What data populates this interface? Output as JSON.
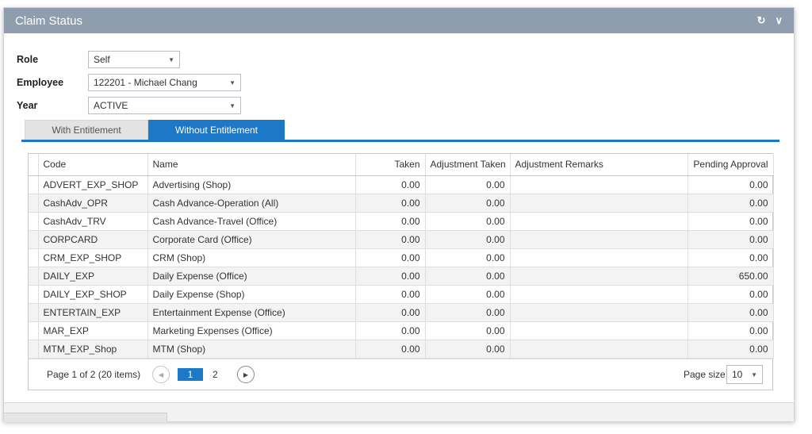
{
  "panel": {
    "title": "Claim Status",
    "refresh_icon": "refresh-icon",
    "collapse_icon": "chevron-down-icon"
  },
  "filters": {
    "role": {
      "label": "Role",
      "value": "Self"
    },
    "employee": {
      "label": "Employee",
      "value": "122201 - Michael Chang"
    },
    "year": {
      "label": "Year",
      "value": "ACTIVE"
    }
  },
  "tabs": [
    {
      "label": "With Entitlement",
      "active": false
    },
    {
      "label": "Without Entitlement",
      "active": true
    }
  ],
  "grid": {
    "headers": [
      "Code",
      "Name",
      "Taken",
      "Adjustment Taken",
      "Adjustment Remarks",
      "Pending Approval"
    ],
    "rows": [
      [
        "ADVERT_EXP_SHOP",
        "Advertising (Shop)",
        "0.00",
        "0.00",
        "",
        "0.00"
      ],
      [
        "CashAdv_OPR",
        "Cash Advance-Operation (All)",
        "0.00",
        "0.00",
        "",
        "0.00"
      ],
      [
        "CashAdv_TRV",
        "Cash Advance-Travel (Office)",
        "0.00",
        "0.00",
        "",
        "0.00"
      ],
      [
        "CORPCARD",
        "Corporate Card (Office)",
        "0.00",
        "0.00",
        "",
        "0.00"
      ],
      [
        "CRM_EXP_SHOP",
        "CRM (Shop)",
        "0.00",
        "0.00",
        "",
        "0.00"
      ],
      [
        "DAILY_EXP",
        "Daily Expense (Office)",
        "0.00",
        "0.00",
        "",
        "650.00"
      ],
      [
        "DAILY_EXP_SHOP",
        "Daily Expense (Shop)",
        "0.00",
        "0.00",
        "",
        "0.00"
      ],
      [
        "ENTERTAIN_EXP",
        "Entertainment Expense (Office)",
        "0.00",
        "0.00",
        "",
        "0.00"
      ],
      [
        "MAR_EXP",
        "Marketing Expenses (Office)",
        "0.00",
        "0.00",
        "",
        "0.00"
      ],
      [
        "MTM_EXP_Shop",
        "MTM (Shop)",
        "0.00",
        "0.00",
        "",
        "0.00"
      ]
    ]
  },
  "pager": {
    "info": "Page 1 of 2 (20 items)",
    "pages": [
      "1",
      "2"
    ],
    "current": "1",
    "page_size_label": "Page size:",
    "page_size": "10"
  },
  "colors": {
    "header_bg": "#8f9eae",
    "accent": "#1d78c8"
  }
}
